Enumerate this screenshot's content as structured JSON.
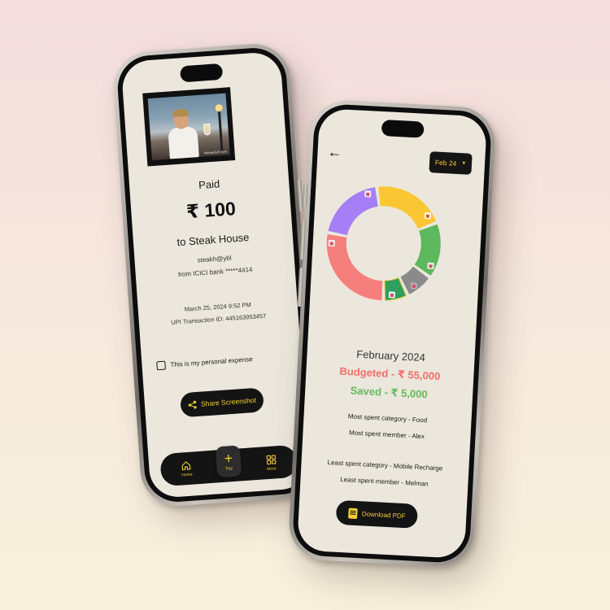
{
  "payment_screen": {
    "gif_watermark": "MakeAGIF.com",
    "status": "Paid",
    "amount": "₹ 100",
    "merchant": "to Steak House",
    "upi_id": "steakh@ybl",
    "bank": "from ICICI bank *****4414",
    "date": "March 25, 2024 9:52 PM",
    "transaction": "UPI Transaction ID: 445163953457",
    "personal_expense_label": "This is my personal expense",
    "personal_expense_checked": false,
    "share_button": "Share Screenshot",
    "tabbar": {
      "home": "Home",
      "pay": "Pay",
      "more": "More"
    }
  },
  "budget_screen": {
    "month_selector": "Feb 24",
    "period_title": "February 2024",
    "budgeted": "Budgeted - ₹ 55,000",
    "saved": "Saved - ₹ 5,000",
    "most_spent_category": "Most spent category - Food",
    "most_spent_member": "Most spent member - Alex",
    "least_spent_category": "Least spent category - Mobile Recharge",
    "least_spent_member": "Least spent member - Melman",
    "download_button": "Download PDF"
  },
  "chart_data": {
    "type": "pie",
    "style": "donut",
    "slices": [
      {
        "color": "#fbc634",
        "icon": "shopping-bag-icon",
        "value": 21
      },
      {
        "color": "#5eb85d",
        "icon": "popcorn-icon",
        "value": 16
      },
      {
        "color": "#8a8a8a",
        "icon": "dots-icon",
        "value": 8
      },
      {
        "color": "#2f9e5e",
        "icon": "leaf-pattern-icon",
        "value": 7
      },
      {
        "color": "#f57f7d",
        "icon": "gift-icon",
        "value": 28
      },
      {
        "color": "#a67ff6",
        "icon": "food-bag-icon",
        "value": 20
      }
    ]
  },
  "colors": {
    "accent": "#f3cc3a",
    "budgeted": "#f26d6a",
    "saved": "#63b95a"
  }
}
